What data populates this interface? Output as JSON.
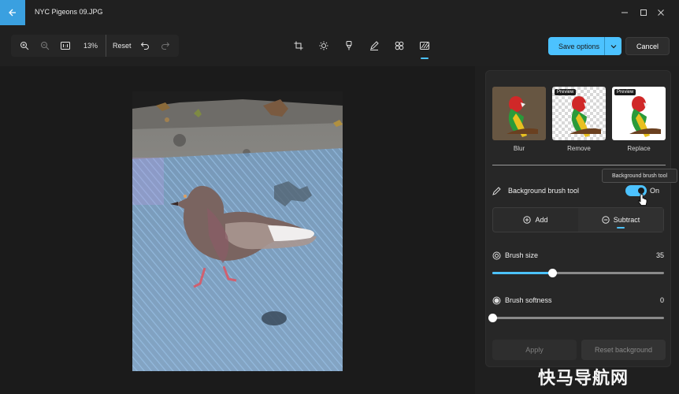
{
  "titlebar": {
    "title": "NYC Pigeons 09.JPG",
    "back_icon": "arrow-left-icon",
    "accent": "#3aa0e0"
  },
  "toolbar": {
    "zoom_value": "13%",
    "reset_label": "Reset",
    "save_options_label": "Save options",
    "cancel_label": "Cancel",
    "tools": [
      "crop-icon",
      "adjust-icon",
      "filter-icon",
      "markup-icon",
      "retouch-icon",
      "background-icon"
    ],
    "active_tool": "background-icon"
  },
  "panel": {
    "effects": [
      {
        "label": "Blur",
        "preview": false
      },
      {
        "label": "Remove",
        "preview": true
      },
      {
        "label": "Replace",
        "preview": true
      }
    ],
    "preview_tag": "Preview",
    "tooltip": "Background brush tool",
    "brush_tool": {
      "label": "Background brush tool",
      "state": "On",
      "enabled": true
    },
    "mode": {
      "add_label": "Add",
      "subtract_label": "Subtract",
      "selected": "Subtract"
    },
    "brush_size": {
      "label": "Brush size",
      "value": "35",
      "level": 0.35
    },
    "brush_softness": {
      "label": "Brush softness",
      "value": "0",
      "level": 0
    },
    "apply_label": "Apply",
    "reset_background_label": "Reset background"
  },
  "watermark": "快马导航网",
  "colors": {
    "accent": "#4cc2ff",
    "background": "#1f1f1f",
    "selection_overlay": "#6fa6dc"
  }
}
